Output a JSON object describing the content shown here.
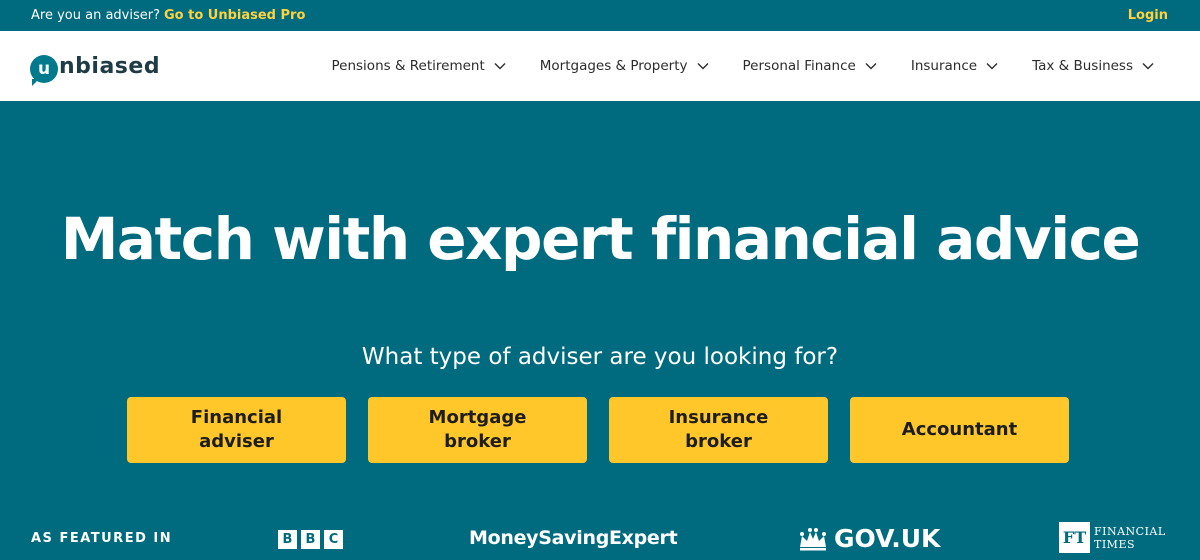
{
  "topbar": {
    "question": "Are you an adviser?",
    "pro_link": "Go to Unbiased Pro",
    "login": "Login"
  },
  "logo": {
    "mark": "u",
    "text": "nbiased"
  },
  "nav": {
    "items": [
      {
        "label": "Pensions & Retirement"
      },
      {
        "label": "Mortgages & Property"
      },
      {
        "label": "Personal Finance"
      },
      {
        "label": "Insurance"
      },
      {
        "label": "Tax & Business"
      }
    ]
  },
  "hero": {
    "title": "Match with expert financial advice",
    "subtitle": "What type of adviser are you looking for?",
    "options": [
      {
        "label": "Financial adviser"
      },
      {
        "label": "Mortgage broker"
      },
      {
        "label": "Insurance broker"
      },
      {
        "label": "Accountant"
      }
    ]
  },
  "featured": {
    "label": "AS FEATURED IN",
    "bbc": [
      "B",
      "B",
      "C"
    ],
    "mse": "MoneySavingExpert",
    "govuk": "GOV.UK",
    "ft_mark": "FT",
    "ft_line1": "FINANCIAL",
    "ft_line2": "TIMES"
  },
  "colors": {
    "brand_teal": "#006b7e",
    "accent_yellow": "#ffc72a",
    "link_yellow": "#ffd23f"
  }
}
